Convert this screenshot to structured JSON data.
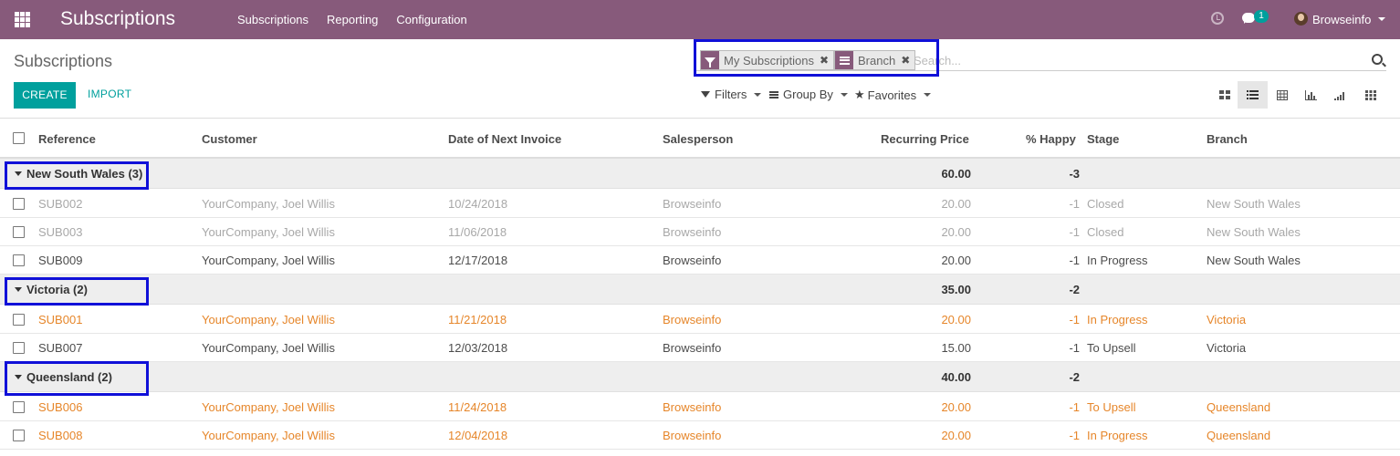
{
  "navbar": {
    "app_title": "Subscriptions",
    "menu": [
      "Subscriptions",
      "Reporting",
      "Configuration"
    ],
    "chat_badge": "1",
    "user_name": "Browseinfo",
    "colors": {
      "navbar": "#875a7b",
      "accent": "#00a09d"
    }
  },
  "control_panel": {
    "breadcrumb": "Subscriptions",
    "create_label": "CREATE",
    "import_label": "IMPORT",
    "facets": [
      {
        "icon": "filter-icon",
        "label": "My Subscriptions"
      },
      {
        "icon": "group-by-icon",
        "label": "Branch"
      }
    ],
    "search_placeholder": "Search...",
    "filters_label": "Filters",
    "group_by_label": "Group By",
    "favorites_label": "Favorites",
    "views": [
      "kanban-view-icon",
      "list-view-icon",
      "grid-view-icon",
      "graph-view-icon",
      "cohort-view-icon",
      "pivot-view-icon"
    ],
    "active_view": "list-view-icon"
  },
  "table": {
    "headers": {
      "reference": "Reference",
      "customer": "Customer",
      "next_invoice": "Date of Next Invoice",
      "salesperson": "Salesperson",
      "recurring_price": "Recurring Price",
      "happy": "% Happy",
      "stage": "Stage",
      "branch": "Branch"
    },
    "groups": [
      {
        "label": "New South Wales (3)",
        "price_total": "60.00",
        "happy_total": "-3",
        "rows": [
          {
            "style": "closed",
            "ref": "SUB002",
            "customer": "YourCompany, Joel Willis",
            "date": "10/24/2018",
            "sales": "Browseinfo",
            "price": "20.00",
            "happy": "-1",
            "stage": "Closed",
            "branch": "New South Wales"
          },
          {
            "style": "closed",
            "ref": "SUB003",
            "customer": "YourCompany, Joel Willis",
            "date": "11/06/2018",
            "sales": "Browseinfo",
            "price": "20.00",
            "happy": "-1",
            "stage": "Closed",
            "branch": "New South Wales"
          },
          {
            "style": "normal",
            "ref": "SUB009",
            "customer": "YourCompany, Joel Willis",
            "date": "12/17/2018",
            "sales": "Browseinfo",
            "price": "20.00",
            "happy": "-1",
            "stage": "In Progress",
            "branch": "New South Wales"
          }
        ]
      },
      {
        "label": "Victoria (2)",
        "price_total": "35.00",
        "happy_total": "-2",
        "rows": [
          {
            "style": "orange",
            "ref": "SUB001",
            "customer": "YourCompany, Joel Willis",
            "date": "11/21/2018",
            "sales": "Browseinfo",
            "price": "20.00",
            "happy": "-1",
            "stage": "In Progress",
            "branch": "Victoria"
          },
          {
            "style": "normal",
            "ref": "SUB007",
            "customer": "YourCompany, Joel Willis",
            "date": "12/03/2018",
            "sales": "Browseinfo",
            "price": "15.00",
            "happy": "-1",
            "stage": "To Upsell",
            "branch": "Victoria"
          }
        ]
      },
      {
        "label": "Queensland (2)",
        "price_total": "40.00",
        "happy_total": "-2",
        "rows": [
          {
            "style": "orange",
            "ref": "SUB006",
            "customer": "YourCompany, Joel Willis",
            "date": "11/24/2018",
            "sales": "Browseinfo",
            "price": "20.00",
            "happy": "-1",
            "stage": "To Upsell",
            "branch": "Queensland"
          },
          {
            "style": "orange",
            "ref": "SUB008",
            "customer": "YourCompany, Joel Willis",
            "date": "12/04/2018",
            "sales": "Browseinfo",
            "price": "20.00",
            "happy": "-1",
            "stage": "In Progress",
            "branch": "Queensland"
          }
        ]
      }
    ]
  }
}
